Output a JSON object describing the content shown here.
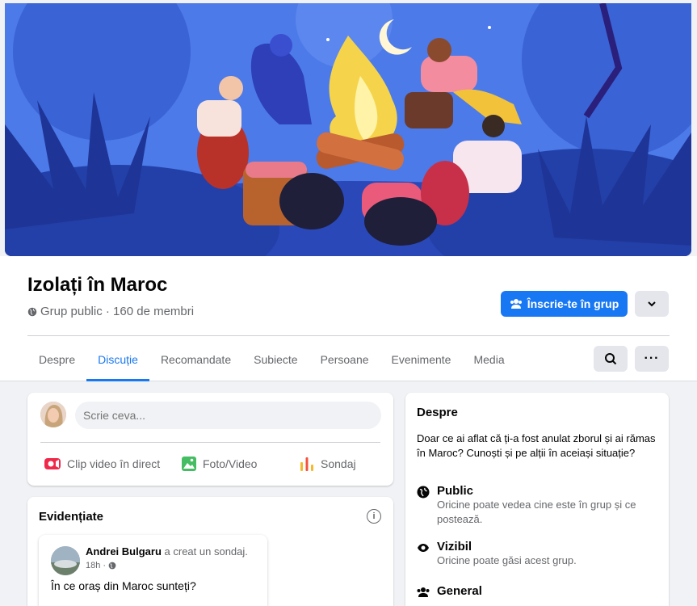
{
  "group": {
    "title": "Izolați în Maroc",
    "meta": "Grup public · 160 de membri",
    "join_label": "Înscrie-te în grup"
  },
  "tabs": [
    {
      "label": "Despre"
    },
    {
      "label": "Discuție"
    },
    {
      "label": "Recomandate"
    },
    {
      "label": "Subiecte"
    },
    {
      "label": "Persoane"
    },
    {
      "label": "Evenimente"
    },
    {
      "label": "Media"
    }
  ],
  "composer": {
    "placeholder": "Scrie ceva...",
    "live_label": "Clip video în direct",
    "photo_label": "Foto/Video",
    "poll_label": "Sondaj"
  },
  "highlights": {
    "title": "Evidențiate",
    "post": {
      "author": "Andrei Bulgaru",
      "action": "a creat un sondaj.",
      "time": "18h ·",
      "text": "În ce oraș din Maroc sunteți?"
    }
  },
  "about": {
    "title": "Despre",
    "description": "Doar ce ai aflat că ți-a fost anulat zborul și ai rămas în Maroc? Cunoști și pe alții în aceiași situație?",
    "items": [
      {
        "icon": "globe-icon",
        "heading": "Public",
        "detail": "Oricine poate vedea cine este în grup și ce postează."
      },
      {
        "icon": "eye-icon",
        "heading": "Vizibil",
        "detail": "Oricine poate găsi acest grup."
      },
      {
        "icon": "people-icon",
        "heading": "General",
        "detail": ""
      }
    ]
  },
  "colors": {
    "accent": "#1877f2",
    "cover_sky": "#4a78e6",
    "live_red": "#f02849",
    "photo_green": "#45bd62",
    "poll_orange": "#f7b928"
  }
}
